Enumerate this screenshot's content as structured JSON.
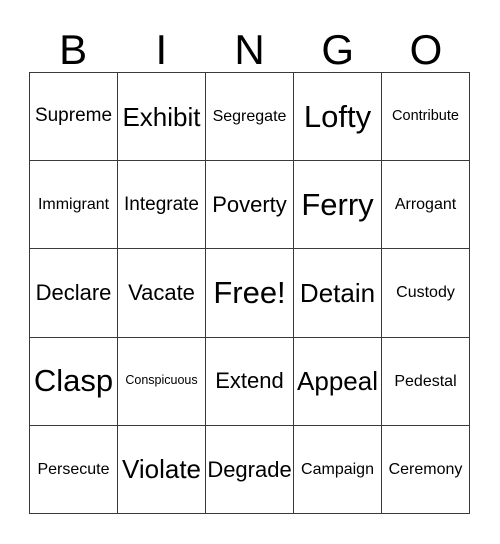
{
  "card": {
    "title": "BINGO",
    "header_letters": [
      "B",
      "I",
      "N",
      "G",
      "O"
    ],
    "grid_size": "5x5",
    "text_color": "#000000",
    "border_color": "#3a3a3a",
    "background_color": "#ffffff",
    "rows": [
      [
        {
          "label": "Supreme",
          "size": "m"
        },
        {
          "label": "Exhibit",
          "size": "xl"
        },
        {
          "label": "Segregate",
          "size": "s"
        },
        {
          "label": "Lofty",
          "size": "xxl"
        },
        {
          "label": "Contribute",
          "size": "xs"
        }
      ],
      [
        {
          "label": "Immigrant",
          "size": "s"
        },
        {
          "label": "Integrate",
          "size": "m"
        },
        {
          "label": "Poverty",
          "size": "l"
        },
        {
          "label": "Ferry",
          "size": "xxl"
        },
        {
          "label": "Arrogant",
          "size": "s"
        }
      ],
      [
        {
          "label": "Declare",
          "size": "l"
        },
        {
          "label": "Vacate",
          "size": "l"
        },
        {
          "label": "Free!",
          "size": "xxl"
        },
        {
          "label": "Detain",
          "size": "xl"
        },
        {
          "label": "Custody",
          "size": "s"
        }
      ],
      [
        {
          "label": "Clasp",
          "size": "xxl"
        },
        {
          "label": "Conspicuous",
          "size": "xxs"
        },
        {
          "label": "Extend",
          "size": "l"
        },
        {
          "label": "Appeal",
          "size": "xl"
        },
        {
          "label": "Pedestal",
          "size": "s"
        }
      ],
      [
        {
          "label": "Persecute",
          "size": "s"
        },
        {
          "label": "Violate",
          "size": "xl"
        },
        {
          "label": "Degrade",
          "size": "l"
        },
        {
          "label": "Campaign",
          "size": "s"
        },
        {
          "label": "Ceremony",
          "size": "s"
        }
      ]
    ]
  }
}
